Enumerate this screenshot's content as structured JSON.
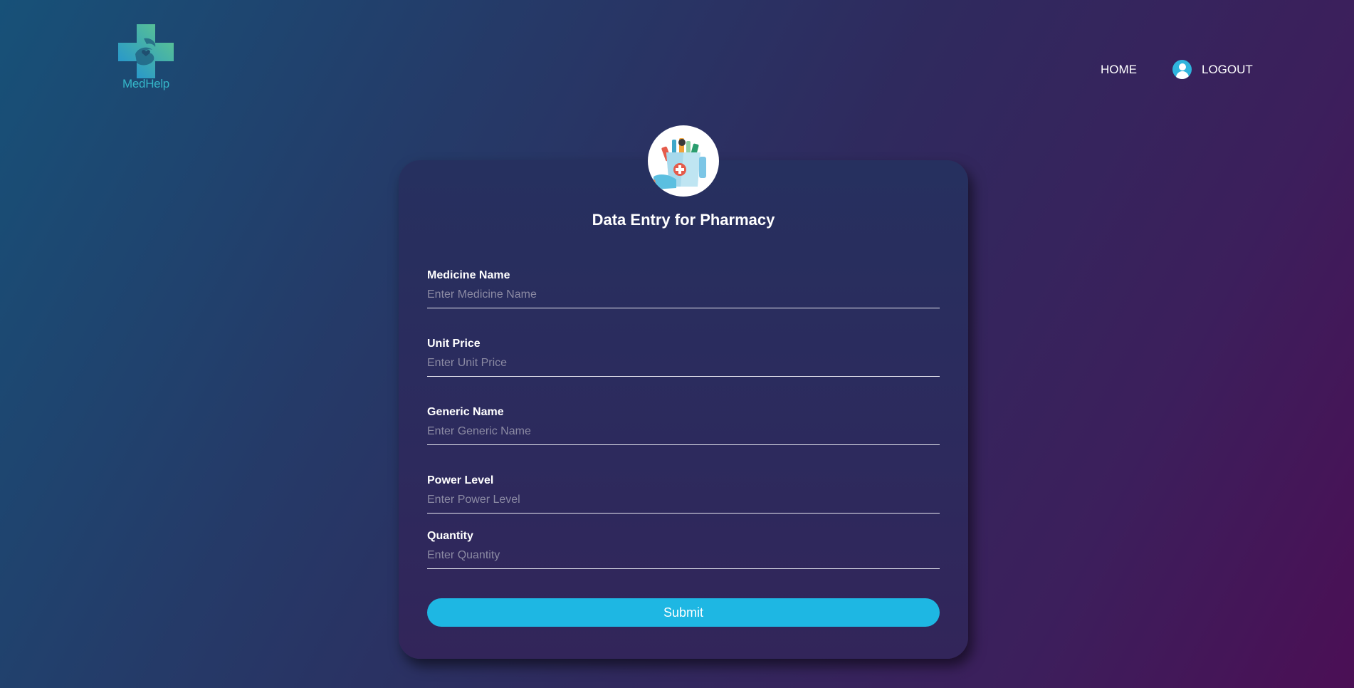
{
  "brand": {
    "logo_text": "MedHelp",
    "logo_icon": "medical-cross-hands-logo"
  },
  "nav": {
    "home_label": "HOME",
    "logout_label": "LOGOUT",
    "logout_icon": "user-avatar-icon"
  },
  "form": {
    "badge_icon": "pharmacy-bag-icon",
    "title": "Data Entry for Pharmacy",
    "fields": [
      {
        "label": "Medicine Name",
        "placeholder": "Enter Medicine Name",
        "value": ""
      },
      {
        "label": "Unit Price",
        "placeholder": "Enter Unit Price",
        "value": ""
      },
      {
        "label": "Generic Name",
        "placeholder": "Enter Generic Name",
        "value": ""
      },
      {
        "label": "Power Level",
        "placeholder": "Enter Power Level",
        "value": ""
      },
      {
        "label": "Quantity",
        "placeholder": "Enter Quantity",
        "value": ""
      }
    ],
    "submit_label": "Submit"
  },
  "colors": {
    "accent": "#1eb7e3",
    "bg_start": "#175178",
    "bg_end": "#4b0f55",
    "card": "#2b2c5e"
  }
}
